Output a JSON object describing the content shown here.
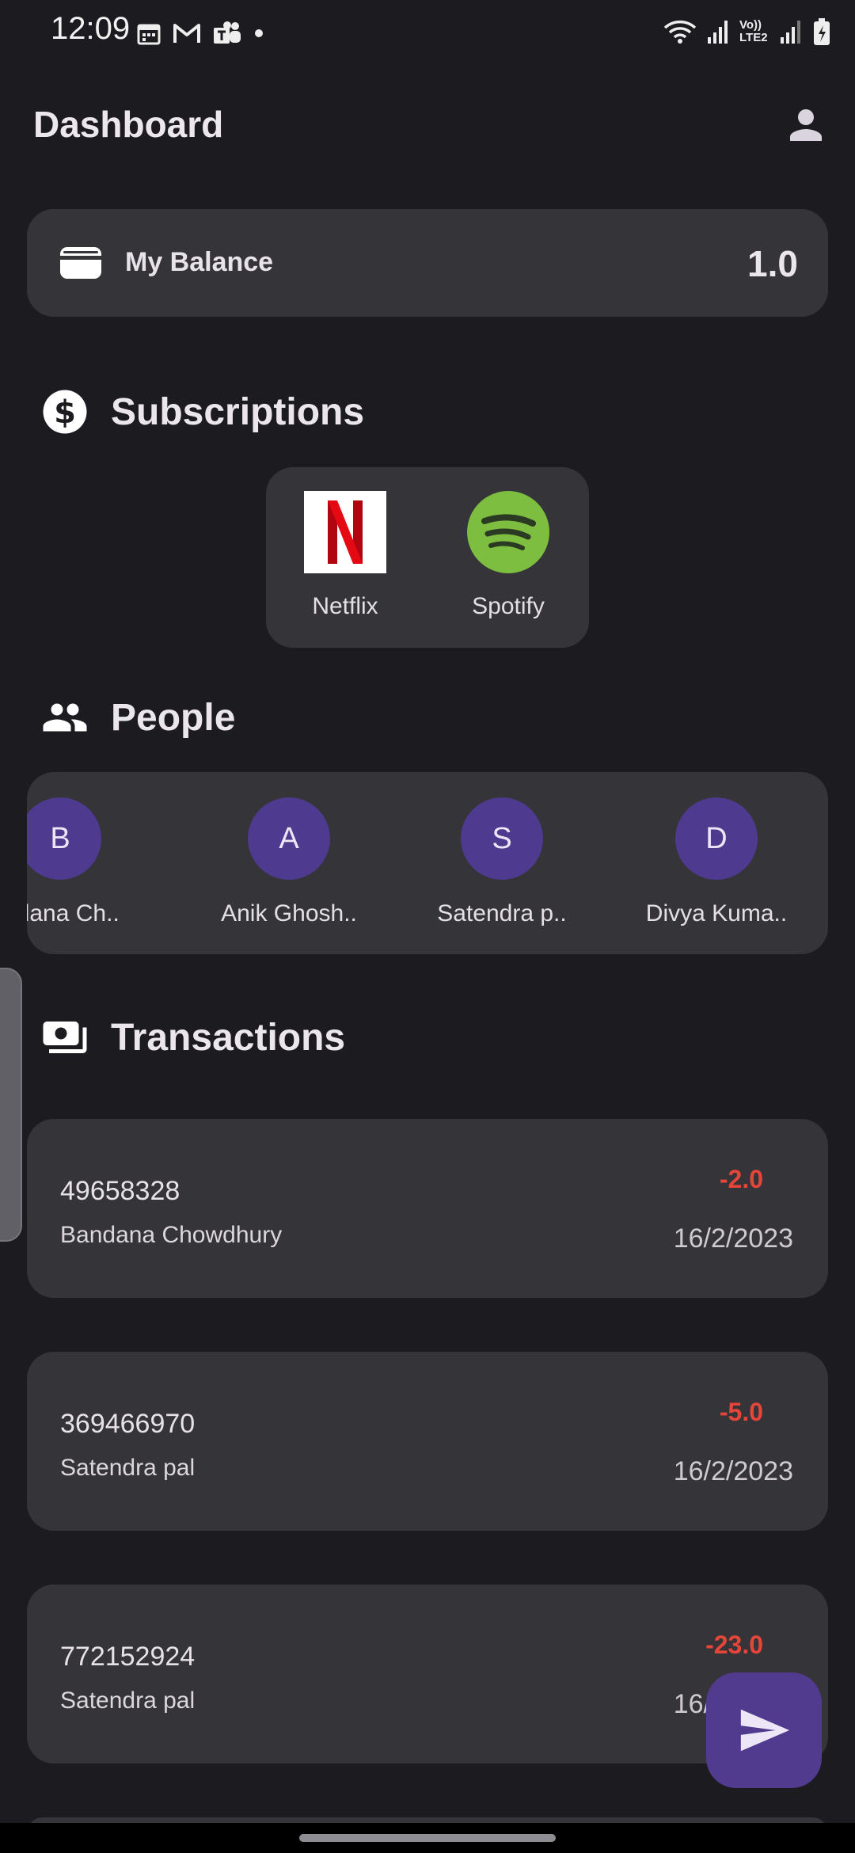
{
  "status_bar": {
    "time": "12:09",
    "network_label": "Vo)) LTE2"
  },
  "app_bar": {
    "title": "Dashboard"
  },
  "balance": {
    "label": "My Balance",
    "value": "1.0"
  },
  "subscriptions": {
    "title": "Subscriptions",
    "items": [
      {
        "label": "Netflix",
        "icon": "netflix-logo"
      },
      {
        "label": "Spotify",
        "icon": "spotify-logo"
      }
    ]
  },
  "people": {
    "title": "People",
    "items": [
      {
        "initial": "B",
        "name": "Bandana Ch..",
        "visible_name": "ndana Ch.."
      },
      {
        "initial": "A",
        "name": "Anik Ghosh.."
      },
      {
        "initial": "S",
        "name": "Satendra p.."
      },
      {
        "initial": "D",
        "name": "Divya Kuma.."
      }
    ]
  },
  "transactions": {
    "title": "Transactions",
    "items": [
      {
        "id": "49658328",
        "name": "Bandana Chowdhury",
        "amount": "-2.0",
        "date": "16/2/2023"
      },
      {
        "id": "369466970",
        "name": "Satendra pal",
        "amount": "-5.0",
        "date": "16/2/2023"
      },
      {
        "id": "772152924",
        "name": "Satendra pal",
        "amount": "-23.0",
        "date": "16/2/2023"
      }
    ]
  },
  "colors": {
    "background": "#1c1b20",
    "card": "#353438",
    "accent": "#503b8e",
    "avatar": "#4e3a8e",
    "negative_amount": "#e6453a"
  }
}
